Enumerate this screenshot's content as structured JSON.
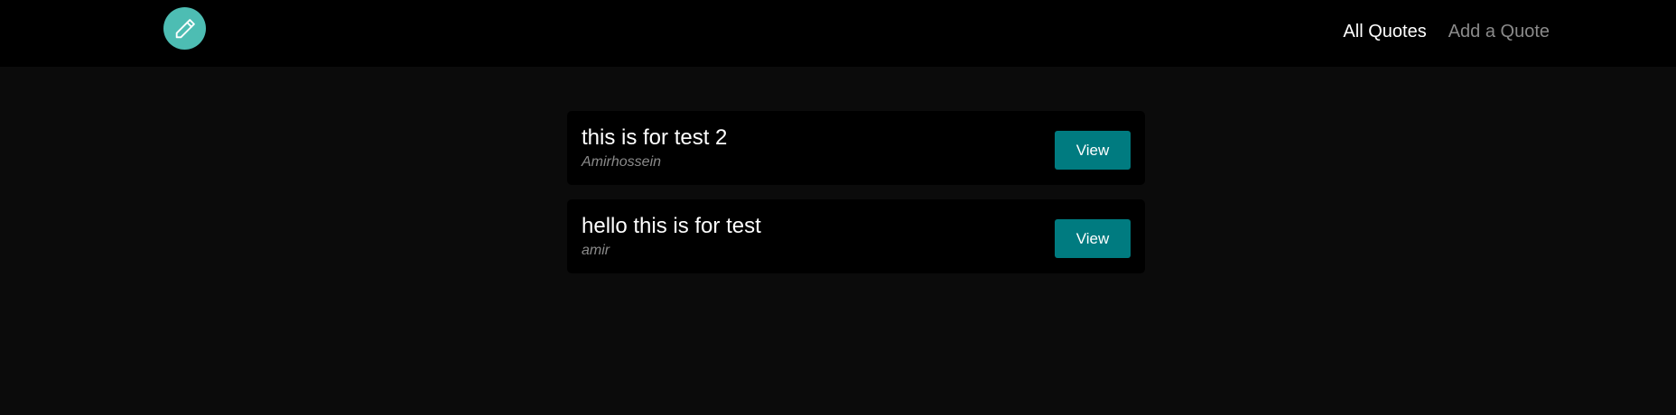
{
  "header": {
    "logo_icon": "pencil-icon",
    "nav": {
      "all_quotes": "All Quotes",
      "add_quote": "Add a Quote"
    }
  },
  "quotes": [
    {
      "text": "this is for test 2",
      "author": "Amirhossein",
      "button": "View"
    },
    {
      "text": "hello this is for test",
      "author": "amir",
      "button": "View"
    }
  ],
  "colors": {
    "accent": "#4dbdb3",
    "button": "#007b80",
    "background": "#0b0b0b",
    "card": "#000000"
  }
}
